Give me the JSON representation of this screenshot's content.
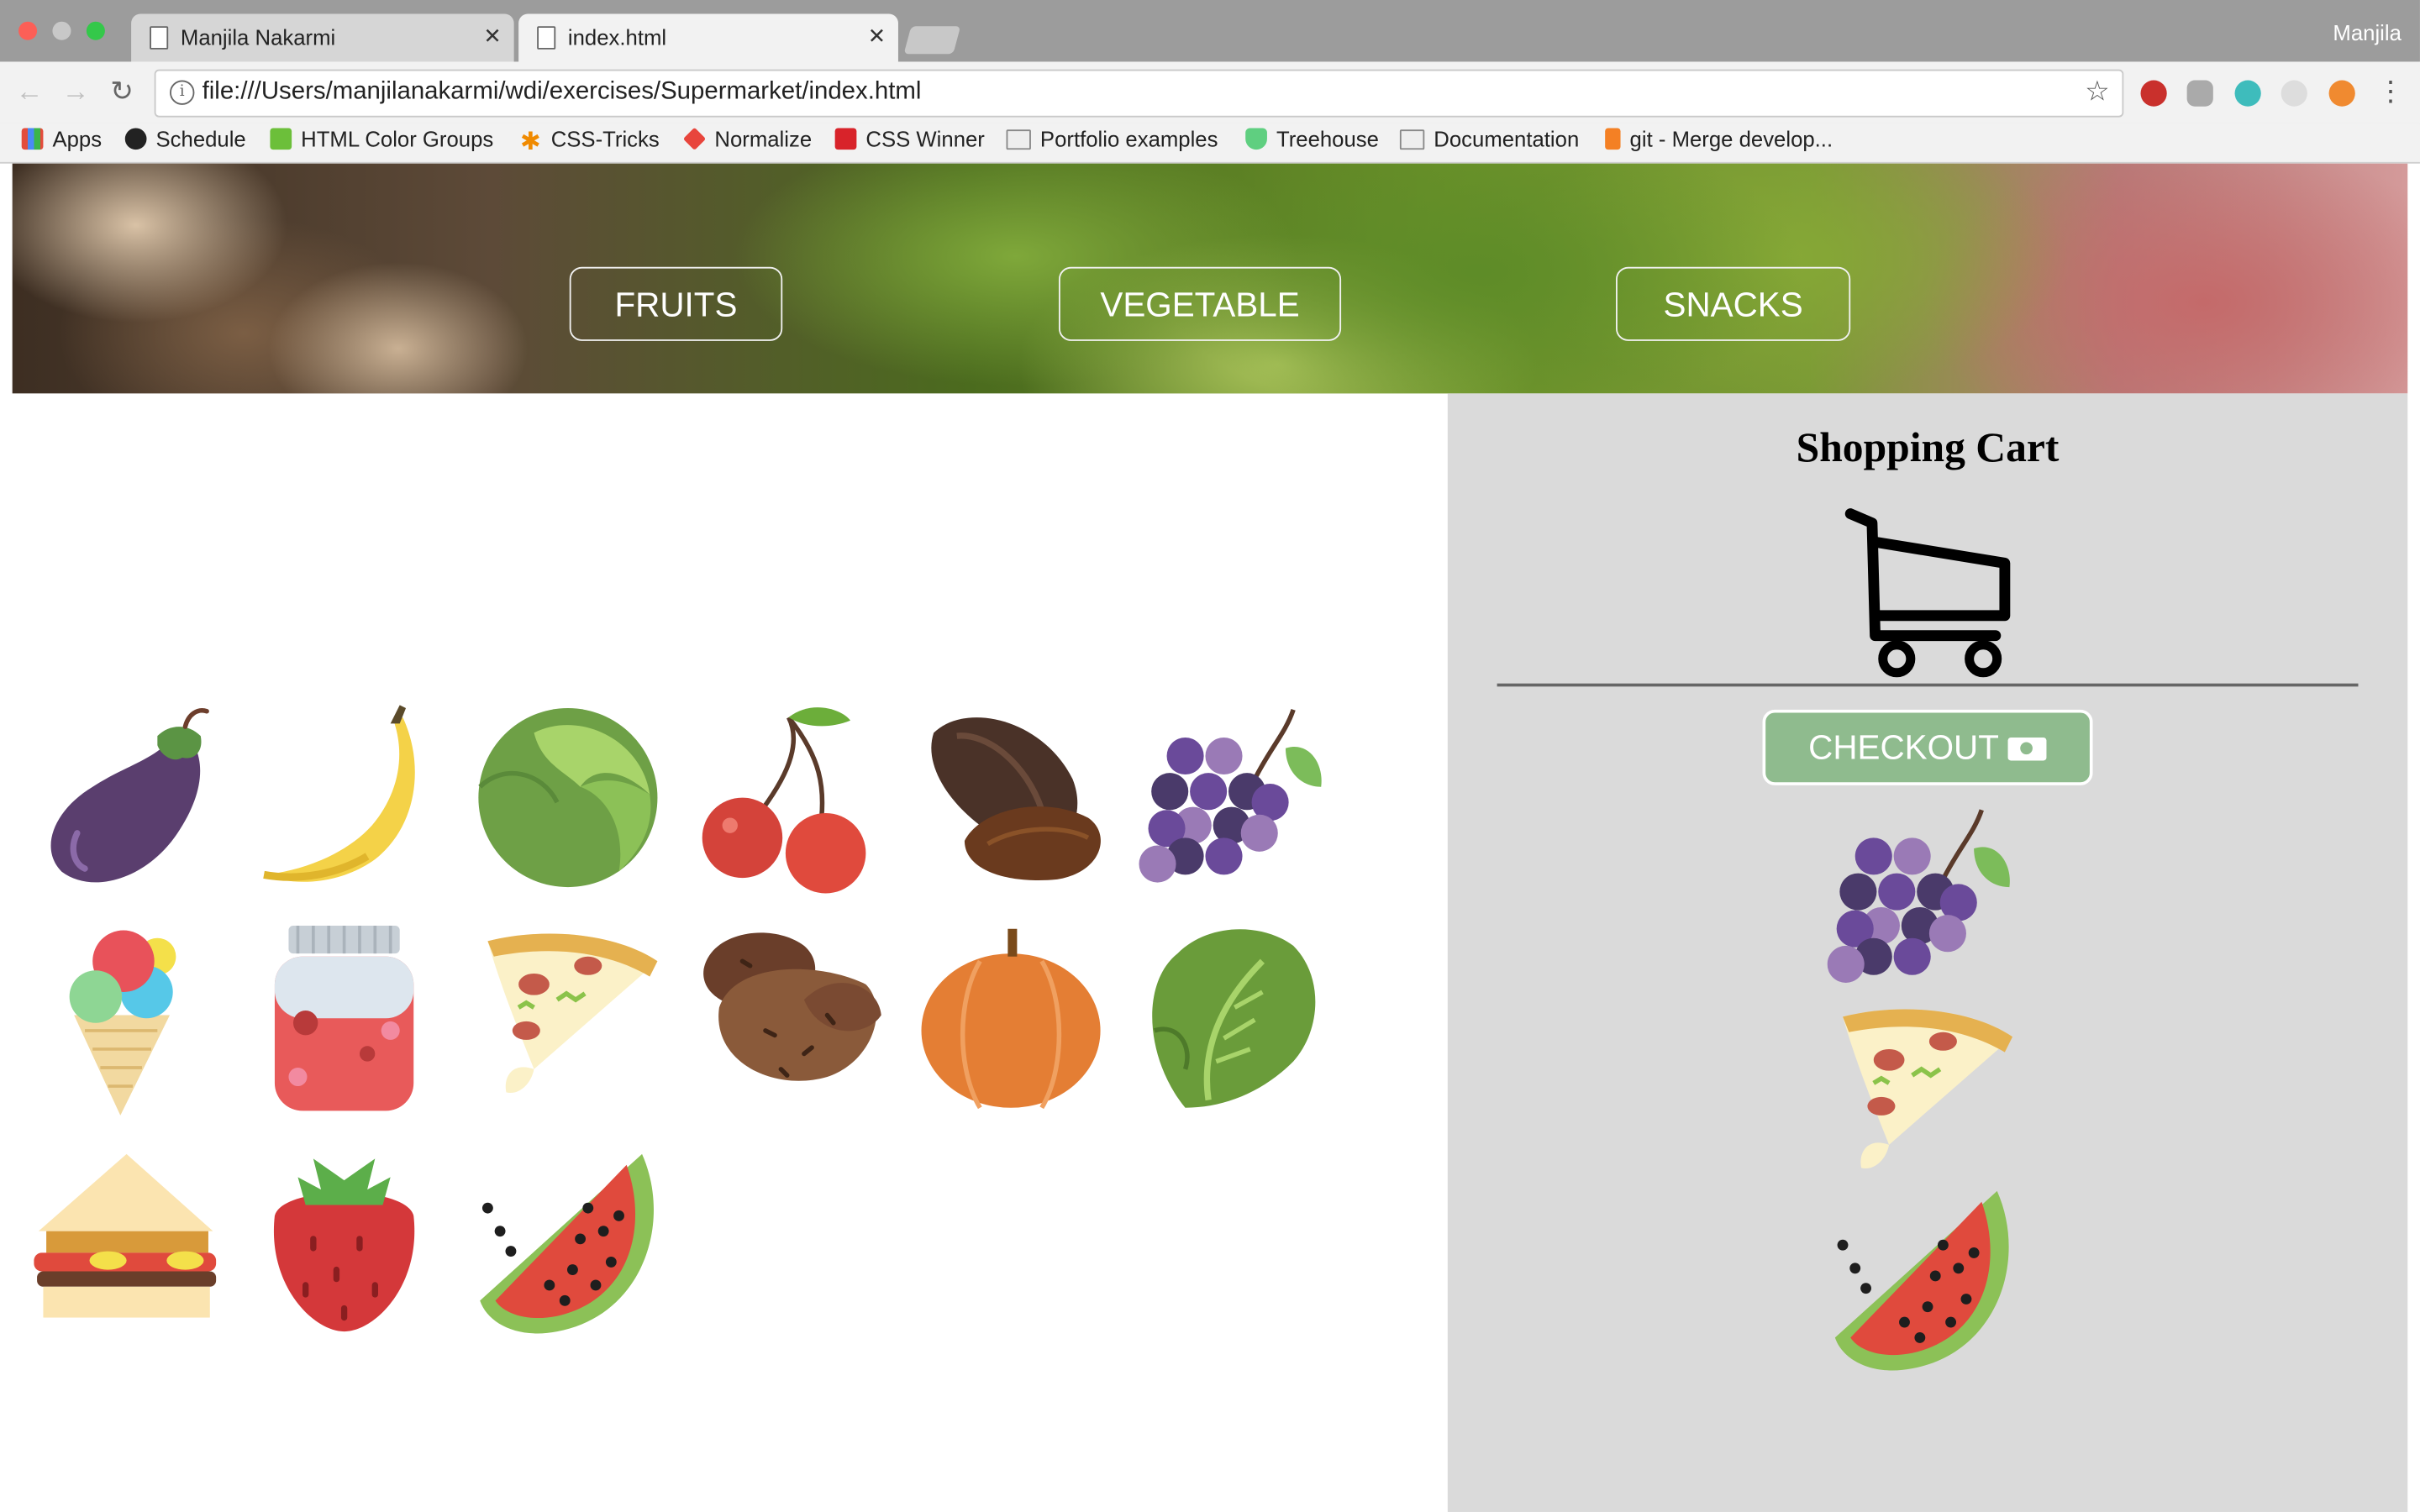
{
  "browser": {
    "tabs": [
      {
        "title": "Manjila Nakarmi"
      },
      {
        "title": "index.html"
      }
    ],
    "profile_name": "Manjila",
    "url": "file:///Users/manjilanakarmi/wdi/exercises/Supermarket/index.html",
    "bookmarks": [
      {
        "label": "Apps",
        "icon": "apps-grid-icon"
      },
      {
        "label": "Schedule",
        "icon": "github-icon"
      },
      {
        "label": "HTML Color Groups",
        "icon": "color-groups-icon"
      },
      {
        "label": "CSS-Tricks",
        "icon": "asterisk-icon"
      },
      {
        "label": "Normalize",
        "icon": "normalize-icon"
      },
      {
        "label": "CSS Winner",
        "icon": "css-winner-icon"
      },
      {
        "label": "Portfolio examples",
        "icon": "folder-icon"
      },
      {
        "label": "Treehouse",
        "icon": "treehouse-icon"
      },
      {
        "label": "Documentation",
        "icon": "folder-icon"
      },
      {
        "label": "git - Merge develop...",
        "icon": "stackoverflow-icon"
      }
    ],
    "extensions": [
      "adblock-icon",
      "bug-icon",
      "m-icon",
      "moon-icon",
      "lifesaver-icon"
    ]
  },
  "nav": {
    "fruits": "FRUITS",
    "vegetable": "VEGETABLE",
    "snacks": "SNACKS"
  },
  "products": [
    {
      "name": "eggplant"
    },
    {
      "name": "banana"
    },
    {
      "name": "cabbage"
    },
    {
      "name": "cherries"
    },
    {
      "name": "almonds"
    },
    {
      "name": "grapes"
    },
    {
      "name": "ice-cream"
    },
    {
      "name": "jam"
    },
    {
      "name": "pizza"
    },
    {
      "name": "potatoes"
    },
    {
      "name": "pumpkin"
    },
    {
      "name": "lettuce"
    },
    {
      "name": "sandwich"
    },
    {
      "name": "strawberry"
    },
    {
      "name": "watermelon"
    }
  ],
  "cart": {
    "title": "Shopping Cart",
    "checkout_label": "CHECKOUT",
    "items": [
      {
        "name": "grapes"
      },
      {
        "name": "pizza"
      },
      {
        "name": "watermelon"
      }
    ]
  },
  "colors": {
    "checkout_bg": "#8fbb8e",
    "cart_panel_bg": "#dadada"
  }
}
